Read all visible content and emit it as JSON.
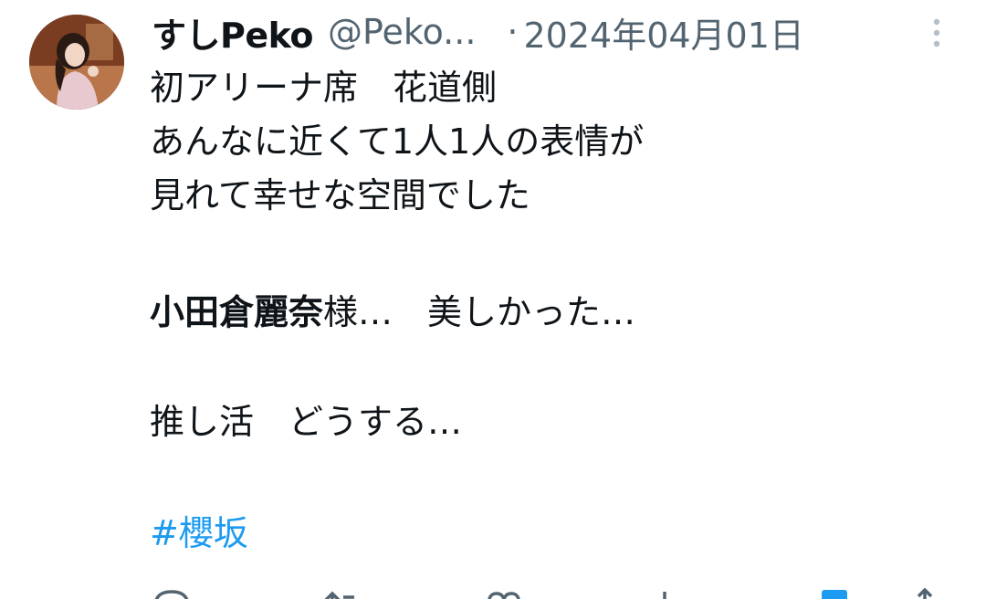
{
  "tweet": {
    "display_name": "すしPeko",
    "handle": "@Peko...",
    "separator": "·",
    "date": "2024年04月01日",
    "lines": {
      "l1": "初アリーナ席　花道側",
      "l2": "あんなに近くて1人1人の表情が",
      "l3": "見れて幸せな空間でした",
      "mention": "小田倉麗奈",
      "l4_rest": "様…　美しかった…",
      "l5": "推し活　どうする…",
      "hashtag": "#櫻坂"
    }
  },
  "icons": {
    "avatar": "user-avatar",
    "more": "more-vertical-icon",
    "reply": "reply-icon",
    "retweet": "retweet-icon",
    "like": "heart-icon",
    "views": "views-icon",
    "bookmark": "bookmark-icon",
    "share": "share-icon"
  },
  "colors": {
    "text": "#0f1419",
    "secondary": "#536471",
    "hashtag": "#1d9bf0"
  }
}
